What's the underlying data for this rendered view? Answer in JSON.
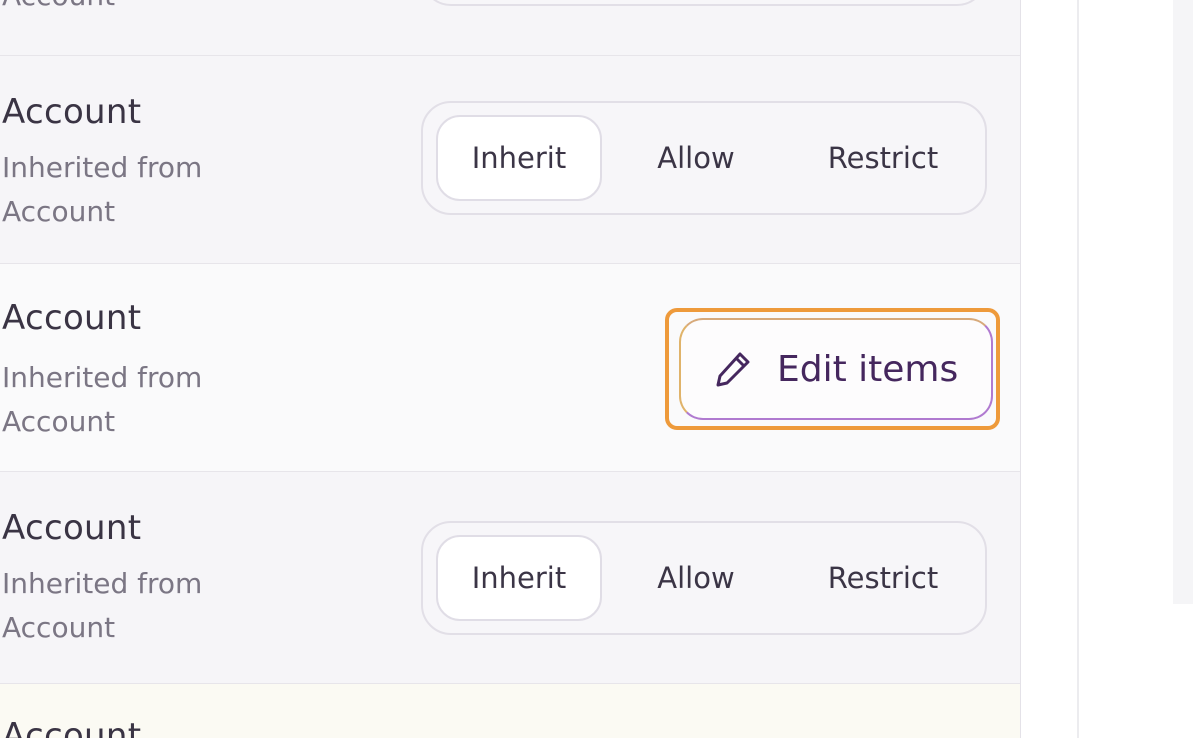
{
  "rows": [
    {
      "type": "partial-top",
      "subtitle": "Account"
    },
    {
      "type": "segmented",
      "title": "Account",
      "subtitle": "Inherited from Account",
      "options": [
        "Inherit",
        "Allow",
        "Restrict"
      ],
      "selected": "Inherit"
    },
    {
      "type": "edit",
      "title": "Account",
      "subtitle": "Inherited from Account",
      "button_label": "Edit items",
      "button_icon": "pencil-icon"
    },
    {
      "type": "segmented",
      "title": "Account",
      "subtitle": "Inherited from Account",
      "options": [
        "Inherit",
        "Allow",
        "Restrict"
      ],
      "selected": "Inherit"
    },
    {
      "type": "partial-bottom",
      "title": "Account"
    }
  ],
  "colors": {
    "highlight_border": "#ee9a3b",
    "edit_text": "#45275e",
    "title_text": "#3a3444",
    "subtitle_text": "#7b7684"
  }
}
